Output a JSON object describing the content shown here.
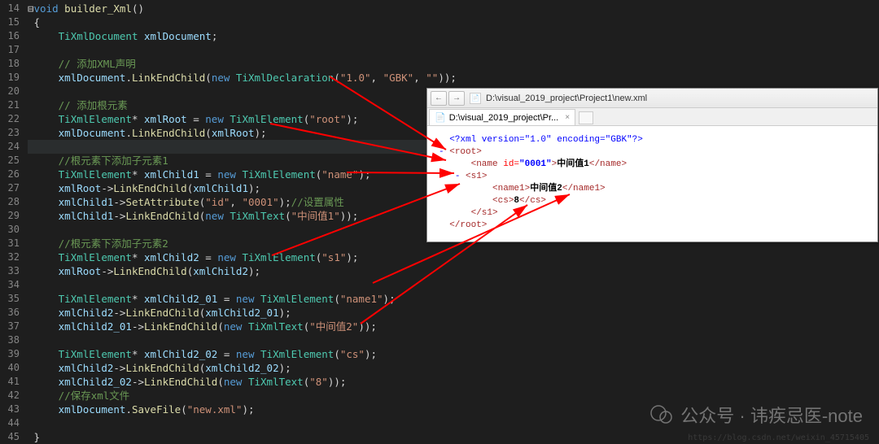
{
  "lineStart": 14,
  "lineEnd": 45,
  "code": {
    "l14": {
      "segs": [
        {
          "c": "kw",
          "t": "void"
        },
        {
          "c": "",
          "t": " "
        },
        {
          "c": "func",
          "t": "builder_Xml"
        },
        {
          "c": "punct",
          "t": "()"
        }
      ],
      "prefix": "⊟"
    },
    "l15": {
      "segs": [
        {
          "c": "brace",
          "t": "{"
        }
      ],
      "indent": 1
    },
    "l16": {
      "segs": [
        {
          "c": "type",
          "t": "TiXmlDocument"
        },
        {
          "c": "",
          "t": " "
        },
        {
          "c": "var",
          "t": "xmlDocument"
        },
        {
          "c": "punct",
          "t": ";"
        }
      ],
      "indent": 2
    },
    "l17": {
      "segs": [],
      "indent": 2
    },
    "l18": {
      "segs": [
        {
          "c": "comment",
          "t": "// 添加XML声明"
        }
      ],
      "indent": 2
    },
    "l19": {
      "segs": [
        {
          "c": "var",
          "t": "xmlDocument"
        },
        {
          "c": "punct",
          "t": "."
        },
        {
          "c": "func",
          "t": "LinkEndChild"
        },
        {
          "c": "punct",
          "t": "("
        },
        {
          "c": "kw",
          "t": "new"
        },
        {
          "c": "",
          "t": " "
        },
        {
          "c": "type",
          "t": "TiXmlDeclaration"
        },
        {
          "c": "punct",
          "t": "("
        },
        {
          "c": "str",
          "t": "\"1.0\""
        },
        {
          "c": "punct",
          "t": ", "
        },
        {
          "c": "str",
          "t": "\"GBK\""
        },
        {
          "c": "punct",
          "t": ", "
        },
        {
          "c": "str",
          "t": "\"\""
        },
        {
          "c": "punct",
          "t": "));"
        }
      ],
      "indent": 2
    },
    "l20": {
      "segs": [],
      "indent": 2
    },
    "l21": {
      "segs": [
        {
          "c": "comment",
          "t": "// 添加根元素"
        }
      ],
      "indent": 2
    },
    "l22": {
      "segs": [
        {
          "c": "type",
          "t": "TiXmlElement"
        },
        {
          "c": "punct",
          "t": "* "
        },
        {
          "c": "var",
          "t": "xmlRoot"
        },
        {
          "c": "",
          "t": " = "
        },
        {
          "c": "kw",
          "t": "new"
        },
        {
          "c": "",
          "t": " "
        },
        {
          "c": "type",
          "t": "TiXmlElement"
        },
        {
          "c": "punct",
          "t": "("
        },
        {
          "c": "str",
          "t": "\"root\""
        },
        {
          "c": "punct",
          "t": ");"
        }
      ],
      "indent": 2
    },
    "l23": {
      "segs": [
        {
          "c": "var",
          "t": "xmlDocument"
        },
        {
          "c": "punct",
          "t": "."
        },
        {
          "c": "func",
          "t": "LinkEndChild"
        },
        {
          "c": "punct",
          "t": "("
        },
        {
          "c": "var",
          "t": "xmlRoot"
        },
        {
          "c": "punct",
          "t": ");"
        }
      ],
      "indent": 2
    },
    "l24": {
      "segs": [],
      "indent": 2,
      "hl": true
    },
    "l25": {
      "segs": [
        {
          "c": "comment",
          "t": "//根元素下添加子元素1"
        }
      ],
      "indent": 2
    },
    "l26": {
      "segs": [
        {
          "c": "type",
          "t": "TiXmlElement"
        },
        {
          "c": "punct",
          "t": "* "
        },
        {
          "c": "var",
          "t": "xmlChild1"
        },
        {
          "c": "",
          "t": " = "
        },
        {
          "c": "kw",
          "t": "new"
        },
        {
          "c": "",
          "t": " "
        },
        {
          "c": "type",
          "t": "TiXmlElement"
        },
        {
          "c": "punct",
          "t": "("
        },
        {
          "c": "str",
          "t": "\"name\""
        },
        {
          "c": "punct",
          "t": ");"
        }
      ],
      "indent": 2
    },
    "l27": {
      "segs": [
        {
          "c": "var",
          "t": "xmlRoot"
        },
        {
          "c": "punct",
          "t": "->"
        },
        {
          "c": "func",
          "t": "LinkEndChild"
        },
        {
          "c": "punct",
          "t": "("
        },
        {
          "c": "var",
          "t": "xmlChild1"
        },
        {
          "c": "punct",
          "t": ");"
        }
      ],
      "indent": 2
    },
    "l28": {
      "segs": [
        {
          "c": "var",
          "t": "xmlChild1"
        },
        {
          "c": "punct",
          "t": "->"
        },
        {
          "c": "func",
          "t": "SetAttribute"
        },
        {
          "c": "punct",
          "t": "("
        },
        {
          "c": "str",
          "t": "\"id\""
        },
        {
          "c": "punct",
          "t": ", "
        },
        {
          "c": "str",
          "t": "\"0001\""
        },
        {
          "c": "punct",
          "t": ");"
        },
        {
          "c": "comment",
          "t": "//设置属性"
        }
      ],
      "indent": 2
    },
    "l29": {
      "segs": [
        {
          "c": "var",
          "t": "xmlChild1"
        },
        {
          "c": "punct",
          "t": "->"
        },
        {
          "c": "func",
          "t": "LinkEndChild"
        },
        {
          "c": "punct",
          "t": "("
        },
        {
          "c": "kw",
          "t": "new"
        },
        {
          "c": "",
          "t": " "
        },
        {
          "c": "type",
          "t": "TiXmlText"
        },
        {
          "c": "punct",
          "t": "("
        },
        {
          "c": "str",
          "t": "\"中间值1\""
        },
        {
          "c": "punct",
          "t": "));"
        }
      ],
      "indent": 2
    },
    "l30": {
      "segs": [],
      "indent": 2
    },
    "l31": {
      "segs": [
        {
          "c": "comment",
          "t": "//根元素下添加子元素2"
        }
      ],
      "indent": 2
    },
    "l32": {
      "segs": [
        {
          "c": "type",
          "t": "TiXmlElement"
        },
        {
          "c": "punct",
          "t": "* "
        },
        {
          "c": "var",
          "t": "xmlChild2"
        },
        {
          "c": "",
          "t": " = "
        },
        {
          "c": "kw",
          "t": "new"
        },
        {
          "c": "",
          "t": " "
        },
        {
          "c": "type",
          "t": "TiXmlElement"
        },
        {
          "c": "punct",
          "t": "("
        },
        {
          "c": "str",
          "t": "\"s1\""
        },
        {
          "c": "punct",
          "t": ");"
        }
      ],
      "indent": 2
    },
    "l33": {
      "segs": [
        {
          "c": "var",
          "t": "xmlRoot"
        },
        {
          "c": "punct",
          "t": "->"
        },
        {
          "c": "func",
          "t": "LinkEndChild"
        },
        {
          "c": "punct",
          "t": "("
        },
        {
          "c": "var",
          "t": "xmlChild2"
        },
        {
          "c": "punct",
          "t": ");"
        }
      ],
      "indent": 2
    },
    "l34": {
      "segs": [],
      "indent": 2
    },
    "l35": {
      "segs": [
        {
          "c": "type",
          "t": "TiXmlElement"
        },
        {
          "c": "punct",
          "t": "* "
        },
        {
          "c": "var",
          "t": "xmlChild2_01"
        },
        {
          "c": "",
          "t": " = "
        },
        {
          "c": "kw",
          "t": "new"
        },
        {
          "c": "",
          "t": " "
        },
        {
          "c": "type",
          "t": "TiXmlElement"
        },
        {
          "c": "punct",
          "t": "("
        },
        {
          "c": "str",
          "t": "\"name1\""
        },
        {
          "c": "punct",
          "t": ");"
        }
      ],
      "indent": 2
    },
    "l36": {
      "segs": [
        {
          "c": "var",
          "t": "xmlChild2"
        },
        {
          "c": "punct",
          "t": "->"
        },
        {
          "c": "func",
          "t": "LinkEndChild"
        },
        {
          "c": "punct",
          "t": "("
        },
        {
          "c": "var",
          "t": "xmlChild2_01"
        },
        {
          "c": "punct",
          "t": ");"
        }
      ],
      "indent": 2
    },
    "l37": {
      "segs": [
        {
          "c": "var",
          "t": "xmlChild2_01"
        },
        {
          "c": "punct",
          "t": "->"
        },
        {
          "c": "func",
          "t": "LinkEndChild"
        },
        {
          "c": "punct",
          "t": "("
        },
        {
          "c": "kw",
          "t": "new"
        },
        {
          "c": "",
          "t": " "
        },
        {
          "c": "type",
          "t": "TiXmlText"
        },
        {
          "c": "punct",
          "t": "("
        },
        {
          "c": "str",
          "t": "\"中间值2\""
        },
        {
          "c": "punct",
          "t": "));"
        }
      ],
      "indent": 2
    },
    "l38": {
      "segs": [],
      "indent": 2
    },
    "l39": {
      "segs": [
        {
          "c": "type",
          "t": "TiXmlElement"
        },
        {
          "c": "punct",
          "t": "* "
        },
        {
          "c": "var",
          "t": "xmlChild2_02"
        },
        {
          "c": "",
          "t": " = "
        },
        {
          "c": "kw",
          "t": "new"
        },
        {
          "c": "",
          "t": " "
        },
        {
          "c": "type",
          "t": "TiXmlElement"
        },
        {
          "c": "punct",
          "t": "("
        },
        {
          "c": "str",
          "t": "\"cs\""
        },
        {
          "c": "punct",
          "t": ");"
        }
      ],
      "indent": 2
    },
    "l40": {
      "segs": [
        {
          "c": "var",
          "t": "xmlChild2"
        },
        {
          "c": "punct",
          "t": "->"
        },
        {
          "c": "func",
          "t": "LinkEndChild"
        },
        {
          "c": "punct",
          "t": "("
        },
        {
          "c": "var",
          "t": "xmlChild2_02"
        },
        {
          "c": "punct",
          "t": ");"
        }
      ],
      "indent": 2
    },
    "l41": {
      "segs": [
        {
          "c": "var",
          "t": "xmlChild2_02"
        },
        {
          "c": "punct",
          "t": "->"
        },
        {
          "c": "func",
          "t": "LinkEndChild"
        },
        {
          "c": "punct",
          "t": "("
        },
        {
          "c": "kw",
          "t": "new"
        },
        {
          "c": "",
          "t": " "
        },
        {
          "c": "type",
          "t": "TiXmlText"
        },
        {
          "c": "punct",
          "t": "("
        },
        {
          "c": "str",
          "t": "\"8\""
        },
        {
          "c": "punct",
          "t": "));"
        }
      ],
      "indent": 2
    },
    "l42": {
      "segs": [
        {
          "c": "comment",
          "t": "//保存xml文件"
        }
      ],
      "indent": 2
    },
    "l43": {
      "segs": [
        {
          "c": "var",
          "t": "xmlDocument"
        },
        {
          "c": "punct",
          "t": "."
        },
        {
          "c": "func",
          "t": "SaveFile"
        },
        {
          "c": "punct",
          "t": "("
        },
        {
          "c": "str",
          "t": "\"new.xml\""
        },
        {
          "c": "punct",
          "t": ");"
        }
      ],
      "indent": 2
    },
    "l44": {
      "segs": [],
      "indent": 2
    },
    "l45": {
      "segs": [
        {
          "c": "brace",
          "t": "}"
        }
      ],
      "indent": 1
    }
  },
  "browser": {
    "address": "D:\\visual_2019_project\\Project1\\new.xml",
    "tab": "D:\\visual_2019_project\\Pr...",
    "xml": {
      "decl": "<?xml version=\"1.0\" encoding=\"GBK\"?>",
      "root_open": "<root>",
      "name_open": "<name ",
      "name_attr": "id=",
      "name_attrval": "\"0001\"",
      "name_close": ">",
      "name_text": "中间值1",
      "name_end": "</name>",
      "s1_open": "<s1>",
      "name1_open": "<name1>",
      "name1_text": "中间值2",
      "name1_end": "</name1>",
      "cs_open": "<cs>",
      "cs_text": "8",
      "cs_end": "</cs>",
      "s1_end": "</s1>",
      "root_end": "</root>"
    }
  },
  "watermark": {
    "text": "公众号 · 讳疾忌医-note"
  },
  "footer": "https://blog.csdn.net/weixin_45715405"
}
